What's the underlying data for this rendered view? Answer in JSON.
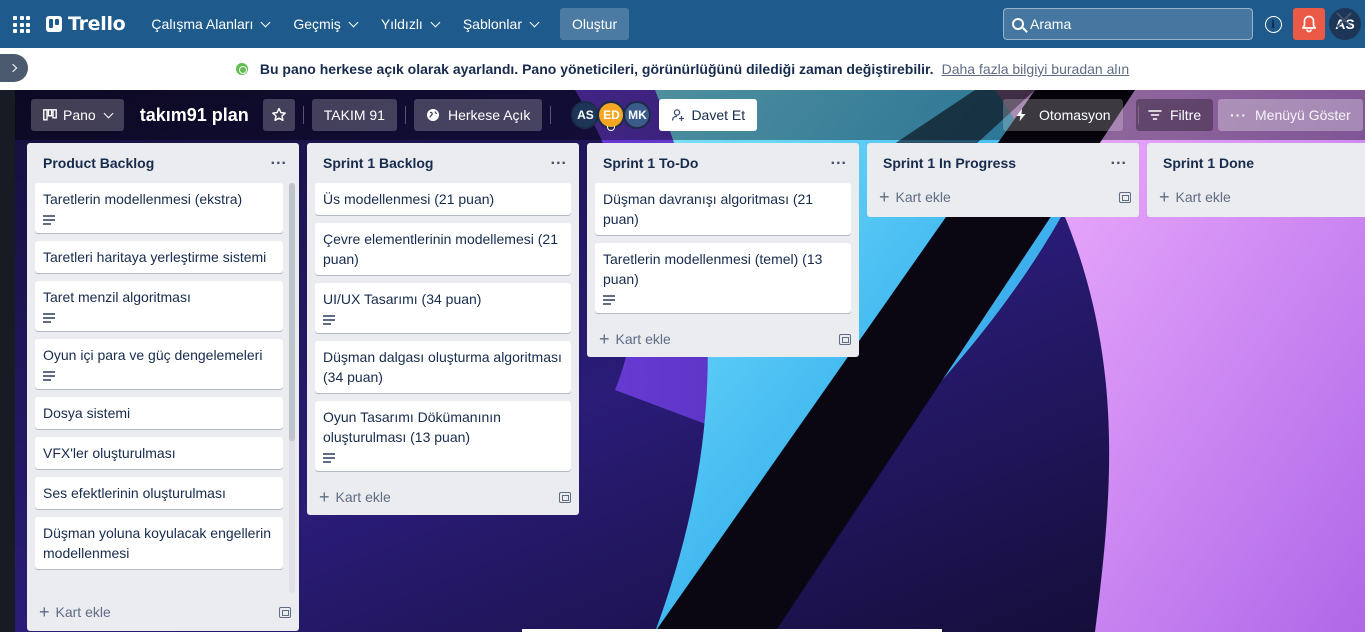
{
  "topnav": {
    "app_name": "Trello",
    "menus": [
      "Çalışma Alanları",
      "Geçmiş",
      "Yıldızlı",
      "Şablonlar"
    ],
    "create_label": "Oluştur",
    "search_placeholder": "Arama",
    "info_symbol": "i",
    "user_initials": "AS",
    "nav_color": "#1e5a8c",
    "bell_color": "#eb5a46"
  },
  "notice": {
    "message": "Bu pano herkese açık olarak ayarlandı. Pano yöneticileri, görünürlüğünü dilediği zaman değiştirebilir.",
    "link": "Daha fazla bilgiyi buradan alın"
  },
  "boardbar": {
    "view_label": "Pano",
    "board_title": "takım91 plan",
    "workspace_label": "TAKIM 91",
    "visibility_label": "Herkese Açık",
    "members": [
      {
        "initials": "AS",
        "color": "#1d3658",
        "text_color": "#ffffff"
      },
      {
        "initials": "ED",
        "color": "#f5a623",
        "text_color": "#ffffff"
      },
      {
        "initials": "MK",
        "color": "#3b5b8a",
        "text_color": "#ffffff"
      }
    ],
    "invite_label": "Davet Et",
    "automation_label": "Otomasyon",
    "filter_label": "Filtre",
    "menu_label": "Menüyü Göster"
  },
  "lists": [
    {
      "title": "Product Backlog",
      "cards": [
        {
          "title": "Taretlerin modellenmesi (ekstra)",
          "has_description": true
        },
        {
          "title": "Taretleri haritaya yerleştirme sistemi",
          "has_description": false
        },
        {
          "title": "Taret menzil algoritması",
          "has_description": true
        },
        {
          "title": "Oyun içi para ve güç dengelemeleri",
          "has_description": true
        },
        {
          "title": "Dosya sistemi",
          "has_description": false
        },
        {
          "title": "VFX'ler oluşturulması",
          "has_description": false
        },
        {
          "title": "Ses efektlerinin oluşturulması",
          "has_description": false
        },
        {
          "title": "Düşman yoluna koyulacak engellerin modellenmesi",
          "has_description": false
        }
      ],
      "add_label": "Kart ekle"
    },
    {
      "title": "Sprint 1 Backlog",
      "cards": [
        {
          "title": "Üs modellenmesi (21 puan)",
          "has_description": false
        },
        {
          "title": "Çevre elementlerinin modellemesi (21 puan)",
          "has_description": false
        },
        {
          "title": "UI/UX Tasarımı (34 puan)",
          "has_description": true
        },
        {
          "title": "Düşman dalgası oluşturma algoritması (34 puan)",
          "has_description": false
        },
        {
          "title": "Oyun Tasarımı Dökümanının oluşturulması (13 puan)",
          "has_description": true
        }
      ],
      "add_label": "Kart ekle"
    },
    {
      "title": "Sprint 1 To-Do",
      "cards": [
        {
          "title": "Düşman davranışı algoritması (21 puan)",
          "has_description": false
        },
        {
          "title": "Taretlerin modellenmesi (temel) (13 puan)",
          "has_description": true
        }
      ],
      "add_label": "Kart ekle"
    },
    {
      "title": "Sprint 1 In Progress",
      "cards": [],
      "add_label": "Kart ekle"
    },
    {
      "title": "Sprint 1 Done",
      "cards": [],
      "add_label": "Kart ekle"
    }
  ]
}
